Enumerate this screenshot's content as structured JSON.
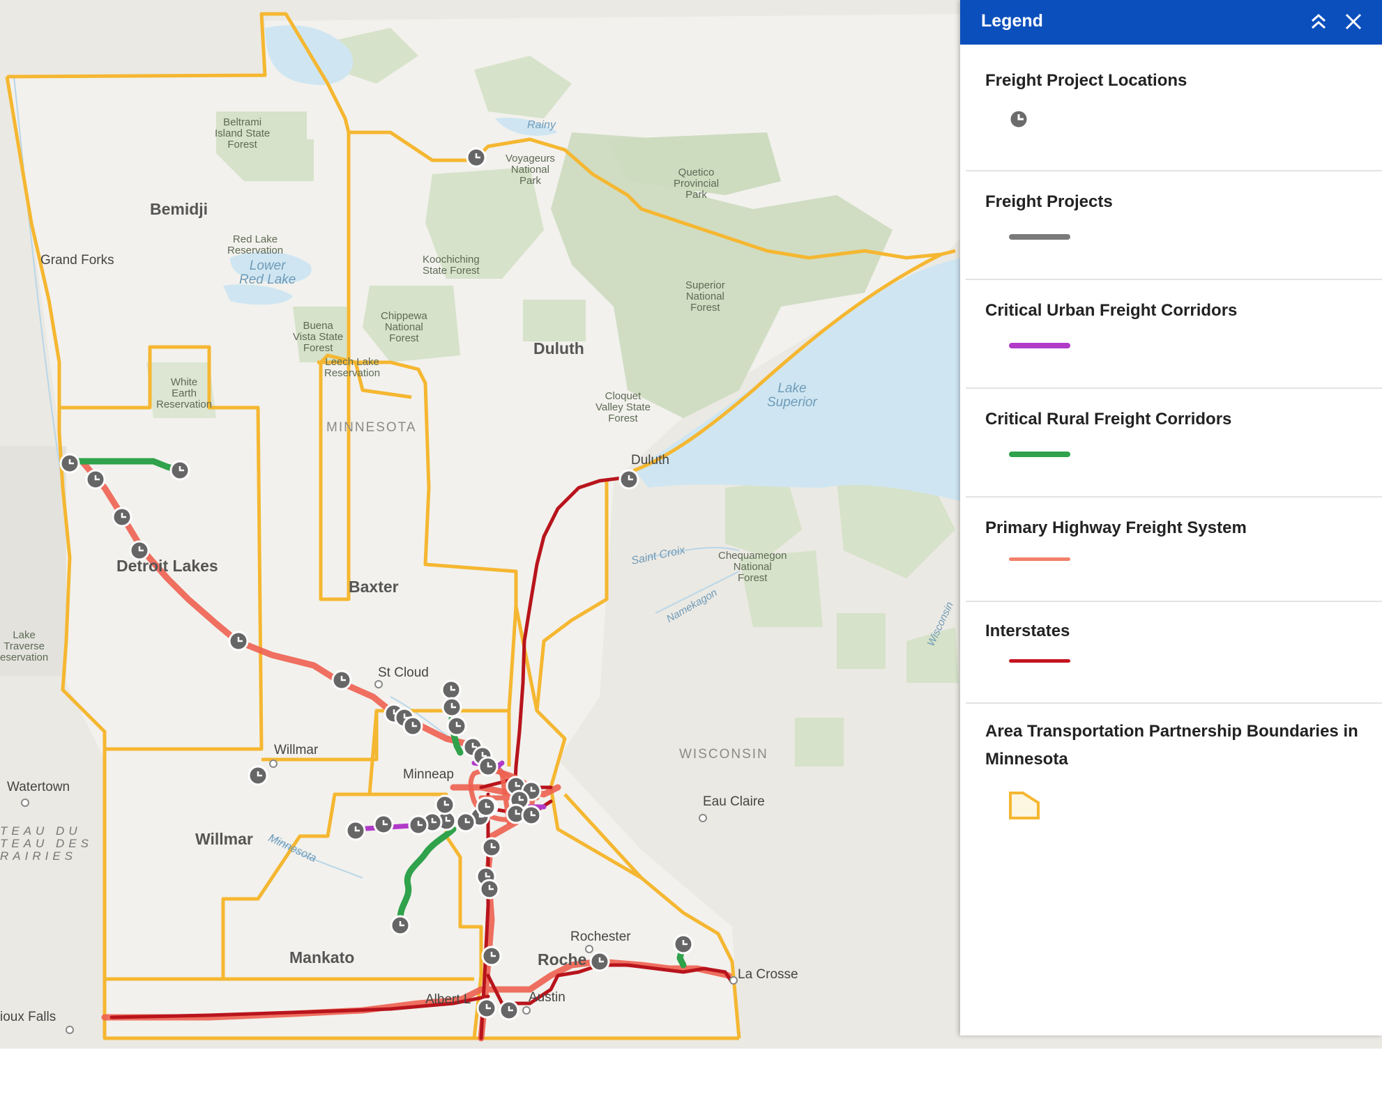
{
  "map": {
    "labels": {
      "bemidji": "Bemidji",
      "grand_forks": "Grand Forks",
      "duluth": "Duluth",
      "duluth_city": "Duluth",
      "detroit_lakes": "Detroit Lakes",
      "baxter": "Baxter",
      "st_cloud": "St Cloud",
      "willmar_city": "Willmar",
      "willmar": "Willmar",
      "minneapolis": "Minneap",
      "watertown": "Watertown",
      "mankato": "Mankato",
      "rochester_city": "Rochester",
      "rochester": "Roche",
      "la_crosse": "La Crosse",
      "eau_claire": "Eau Claire",
      "albert_lea": "Albert L",
      "austin": "Austin",
      "sioux_falls": "ioux Falls",
      "minnesota": "MINNESOTA",
      "wisconsin": "WISCONSIN",
      "beltrami": "Beltrami\nIsland State\nForest",
      "red_lake_res": "Red Lake\nReservation",
      "lower_red_lake": "Lower\nRed Lake",
      "koochiching": "Koochiching\nState Forest",
      "voyageurs": "Voyageurs\nNational\nPark",
      "quetico": "Quetico\nProvincial\nPark",
      "superior_nf": "Superior\nNational\nForest",
      "chippewa": "Chippewa\nNational\nForest",
      "buena_vista": "Buena\nVista State\nForest",
      "leech_lake": "Leech Lake\nReservation",
      "white_earth": "White\nEarth\nReservation",
      "cloquet": "Cloquet\nValley State\nForest",
      "lake_superior": "Lake\nSuperior",
      "saint_croix": "Saint Croix",
      "namekagon": "Namekagon",
      "chequamegon": "Chequamegon\nNational\nForest",
      "lake_traverse": "Lake\nTraverse\neservation",
      "coteau": "TEAU DU\nTEAU DES\nRAIRIES",
      "rainy": "Rainy",
      "minnesota_river": "Minnesota",
      "wisconsin_river": "Wisconsin"
    }
  },
  "legend": {
    "title": "Legend",
    "collapse_icon": "chevron-double-up-icon",
    "close_icon": "close-icon",
    "items": [
      {
        "label": "Freight Project Locations",
        "symbol": "point",
        "color": "#6b6b6b"
      },
      {
        "label": "Freight Projects",
        "symbol": "line",
        "color": "#7a7a7a"
      },
      {
        "label": "Critical Urban Freight Corridors",
        "symbol": "line",
        "color": "#b13ac9"
      },
      {
        "label": "Critical Rural Freight Corridors",
        "symbol": "line",
        "color": "#2fa24b"
      },
      {
        "label": "Primary Highway Freight System",
        "symbol": "line",
        "color": "#f2806a"
      },
      {
        "label": "Interstates",
        "symbol": "line",
        "color": "#c4141f"
      },
      {
        "label": "Area Transportation Partnership Boundaries in Minnesota",
        "symbol": "polygon",
        "color": "#f5b731"
      }
    ]
  },
  "colors": {
    "header_blue": "#0b4fbd",
    "atp_boundary": "#f5b731",
    "interstate": "#b8141c",
    "primary_highway": "#ee6150",
    "rural_corridor": "#2fa24b",
    "urban_corridor": "#b13ac9",
    "project_marker": "#6b6b6b",
    "water": "#cfe6f2",
    "forest": "#d3dfc6"
  }
}
